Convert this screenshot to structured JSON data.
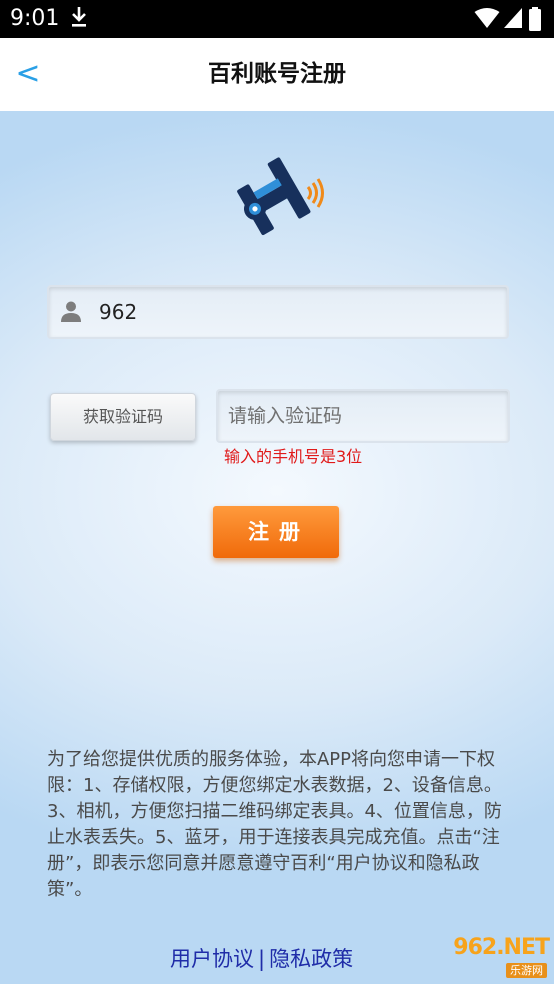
{
  "status_bar": {
    "time": "9:01",
    "icons": [
      "download-icon",
      "wifi-icon",
      "signal-icon",
      "battery-icon"
    ]
  },
  "header": {
    "back_label": "<",
    "title": "百利账号注册"
  },
  "form": {
    "phone_value": "962",
    "get_code_label": "获取验证码",
    "code_placeholder": "请输入验证码",
    "error_message": "输入的手机号是3位",
    "register_label": "注册"
  },
  "notice": {
    "text": "为了给您提供优质的服务体验，本APP将向您申请一下权限：1、存储权限，方便您绑定水表数据，2、设备信息。3、相机，方便您扫描二维码绑定表具。4、位置信息，防止水表丢失。5、蓝牙，用于连接表具完成充值。点击“注册”，即表示您同意并愿意遵守百利“用户协议和隐私政策”。"
  },
  "links": {
    "user_agreement": "用户协议",
    "separator": "|",
    "privacy_policy": "隐私政策"
  },
  "watermark": {
    "main": "962.NET",
    "sub": "乐游网"
  },
  "colors": {
    "accent_blue": "#2aa0e6",
    "register_orange": "#f37a12",
    "error_red": "#e01a1a",
    "link_blue": "#1f2ca8"
  }
}
